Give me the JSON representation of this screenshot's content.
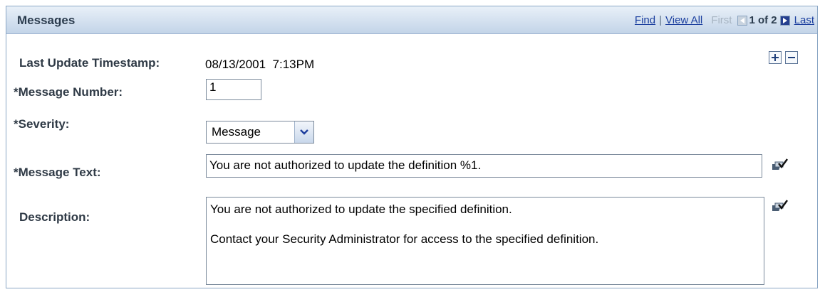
{
  "header": {
    "title": "Messages",
    "find_link": "Find",
    "separator": "|",
    "view_all_link": "View All",
    "first_label": "First",
    "count_text": "1 of 2",
    "last_link": "Last"
  },
  "row_actions": {
    "add_icon": "plus-icon",
    "delete_icon": "minus-icon"
  },
  "fields": {
    "timestamp_label": "Last Update Timestamp:",
    "timestamp_value": "08/13/2001  7:13PM",
    "message_number_label": "*Message Number:",
    "message_number_value": "1",
    "severity_label": "*Severity:",
    "severity_value": "Message",
    "message_text_label": "*Message Text:",
    "message_text_value": "You are not authorized to update the definition %1.",
    "description_label": "Description:",
    "description_value": "You are not authorized to update the specified definition.\n\nContact your Security Administrator for access to the specified definition."
  },
  "icons": {
    "spell_check": "spell-check-icon"
  },
  "colors": {
    "header_text": "#2b3c4e",
    "link": "#1a3e9e",
    "next_button": "#253f8f"
  }
}
